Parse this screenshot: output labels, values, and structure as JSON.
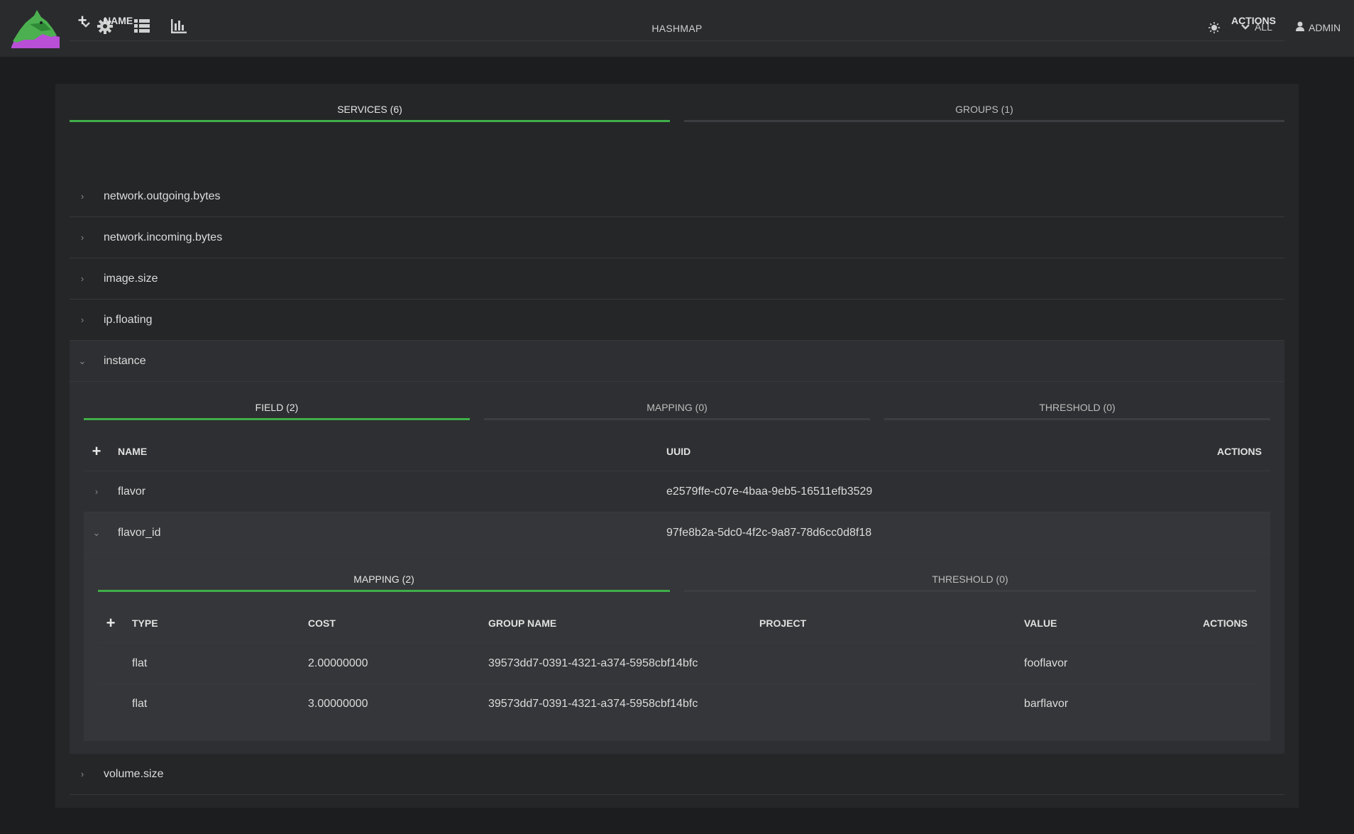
{
  "header": {
    "title": "HASHMAP",
    "scope_label": "ALL",
    "user_label": "ADMIN"
  },
  "services_tabs": [
    {
      "label": "SERVICES (6)",
      "active": true
    },
    {
      "label": "GROUPS (1)",
      "active": false
    }
  ],
  "services_table": {
    "col_name": "NAME",
    "col_actions": "ACTIONS",
    "rows": [
      "network.outgoing.bytes",
      "network.incoming.bytes",
      "image.size",
      "ip.floating",
      "instance",
      "volume.size"
    ]
  },
  "instance_tabs": [
    {
      "label": "FIELD (2)",
      "active": true
    },
    {
      "label": "MAPPING (0)",
      "active": false
    },
    {
      "label": "THRESHOLD (0)",
      "active": false
    }
  ],
  "field_table": {
    "col_name": "NAME",
    "col_uuid": "UUID",
    "col_actions": "ACTIONS",
    "rows": [
      {
        "name": "flavor",
        "uuid": "e2579ffe-c07e-4baa-9eb5-16511efb3529"
      },
      {
        "name": "flavor_id",
        "uuid": "97fe8b2a-5dc0-4f2c-9a87-78d6cc0d8f18"
      }
    ]
  },
  "flavor_id_tabs": [
    {
      "label": "MAPPING (2)",
      "active": true
    },
    {
      "label": "THRESHOLD (0)",
      "active": false
    }
  ],
  "mapping_table": {
    "col_type": "TYPE",
    "col_cost": "COST",
    "col_group": "GROUP NAME",
    "col_project": "PROJECT",
    "col_value": "VALUE",
    "col_actions": "ACTIONS",
    "rows": [
      {
        "type": "flat",
        "cost": "2.00000000",
        "group": "39573dd7-0391-4321-a374-5958cbf14bfc",
        "project": "",
        "value": "fooflavor"
      },
      {
        "type": "flat",
        "cost": "3.00000000",
        "group": "39573dd7-0391-4321-a374-5958cbf14bfc",
        "project": "",
        "value": "barflavor"
      }
    ]
  },
  "colors": {
    "accent": "#3fae49",
    "background": "#1c1d1f",
    "panel": "#252628",
    "topbar": "#2a2b2d"
  }
}
